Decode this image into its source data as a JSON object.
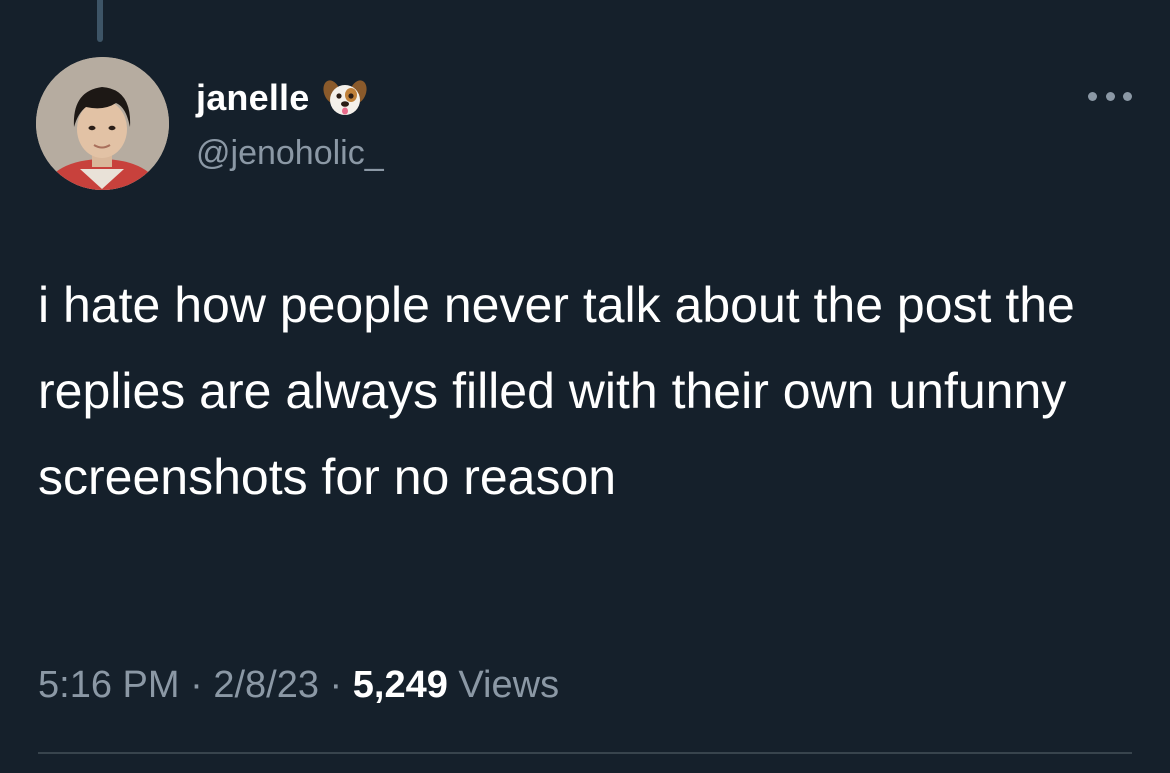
{
  "author": {
    "display_name": "janelle",
    "badge_emoji": "dog-face-icon",
    "handle": "@jenoholic_"
  },
  "more_button_icon": "more-horizontal-icon",
  "tweet": {
    "text": "i hate how people never talk about the post the replies are always filled with their own unfunny screenshots for no reason"
  },
  "meta": {
    "time": "5:16 PM",
    "separator": " · ",
    "date": "2/8/23",
    "views_count": "5,249",
    "views_label": " Views"
  },
  "colors": {
    "background": "#15202b",
    "secondary_text": "#8b98a5",
    "primary_text": "#ffffff",
    "divider": "#38444d",
    "thread_line": "#3d5466"
  }
}
